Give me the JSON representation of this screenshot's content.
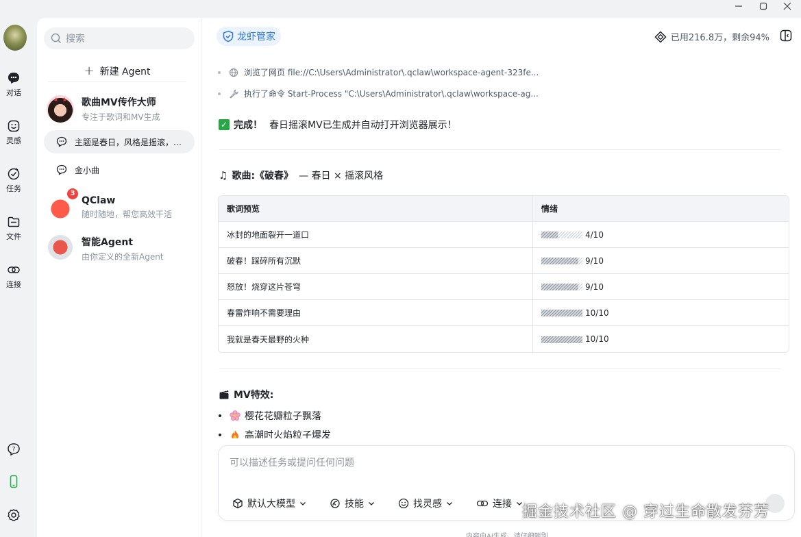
{
  "window": {
    "controls": [
      "minimize-icon",
      "maximize-icon",
      "close-icon"
    ]
  },
  "rail": {
    "items": [
      {
        "label": "对话",
        "icon": "chat-bubble-icon"
      },
      {
        "label": "灵感",
        "icon": "smile-icon"
      },
      {
        "label": "任务",
        "icon": "task-check-icon"
      },
      {
        "label": "文件",
        "icon": "folder-icon"
      },
      {
        "label": "连接",
        "icon": "link-icon"
      }
    ],
    "bottom": [
      "help-icon",
      "phone-icon",
      "settings-icon"
    ]
  },
  "sidebar": {
    "search_placeholder": "搜索",
    "new_agent": "新建 Agent",
    "agents": [
      {
        "name": "歌曲MV传作大师",
        "desc": "专注于歌词和MV生成"
      },
      {
        "name": "QClaw",
        "desc": "随时随地，帮您高效干活",
        "badge": "3"
      },
      {
        "name": "智能Agent",
        "desc": "由你定义的全新Agent"
      }
    ],
    "chats": [
      {
        "title": "主题是春日，风格是摇滚，…"
      },
      {
        "title": "金小曲"
      }
    ]
  },
  "main": {
    "agent_chip": "龙虾管家",
    "usage": "已用216.8万，剩余94%",
    "steps": [
      {
        "text": "浏览了网页 file://C:\\Users\\Administrator\\.qclaw\\workspace-agent-323fe...",
        "icon": "globe-icon"
      },
      {
        "text": "执行了命令 Start-Process \"C:\\Users\\Administrator\\.qclaw\\workspace-ag...",
        "icon": "wrench-icon"
      }
    ],
    "done_label": "完成！",
    "done_text": "春日摇滚MV已生成并自动打开浏览器展示！",
    "song_label": "歌曲:《破春》",
    "song_text": "— 春日 × 摇滚风格",
    "table": {
      "headers": [
        "歌词预览",
        "情绪"
      ],
      "rows": [
        {
          "lyric": "冰封的地面裂开一道口",
          "score": "4/10",
          "level": 0.4
        },
        {
          "lyric": "破春！踩碎所有沉默",
          "score": "9/10",
          "level": 0.9
        },
        {
          "lyric": "怒放！烧穿这片苍穹",
          "score": "9/10",
          "level": 0.9
        },
        {
          "lyric": "春雷炸响不需要理由",
          "score": "10/10",
          "level": 1.0
        },
        {
          "lyric": "我就是春天最野的火种",
          "score": "10/10",
          "level": 1.0
        }
      ]
    },
    "mv_label": "MV特效:",
    "mv_items": [
      {
        "text": "樱花花瓣粒子飘落",
        "icon": "cherry-blossom-icon"
      },
      {
        "text": "高潮时火焰粒子爆发",
        "icon": "fire-icon"
      }
    ],
    "composer": {
      "placeholder": "可以描述任务或提问任何问题",
      "tools": [
        {
          "label": "默认大模型",
          "icon": "cube-icon"
        },
        {
          "label": "技能",
          "icon": "skill-icon"
        },
        {
          "label": "找灵感",
          "icon": "smile-icon"
        },
        {
          "label": "连接",
          "icon": "link-icon"
        }
      ]
    },
    "footer_note": "内容由AI生成，请仔细甄别",
    "watermark": "掘金技术社区 @ 穿过生命散发芬芳"
  },
  "colors": {
    "accent": "#2f78e0",
    "badge": "#f0423f",
    "success": "#28a745"
  }
}
